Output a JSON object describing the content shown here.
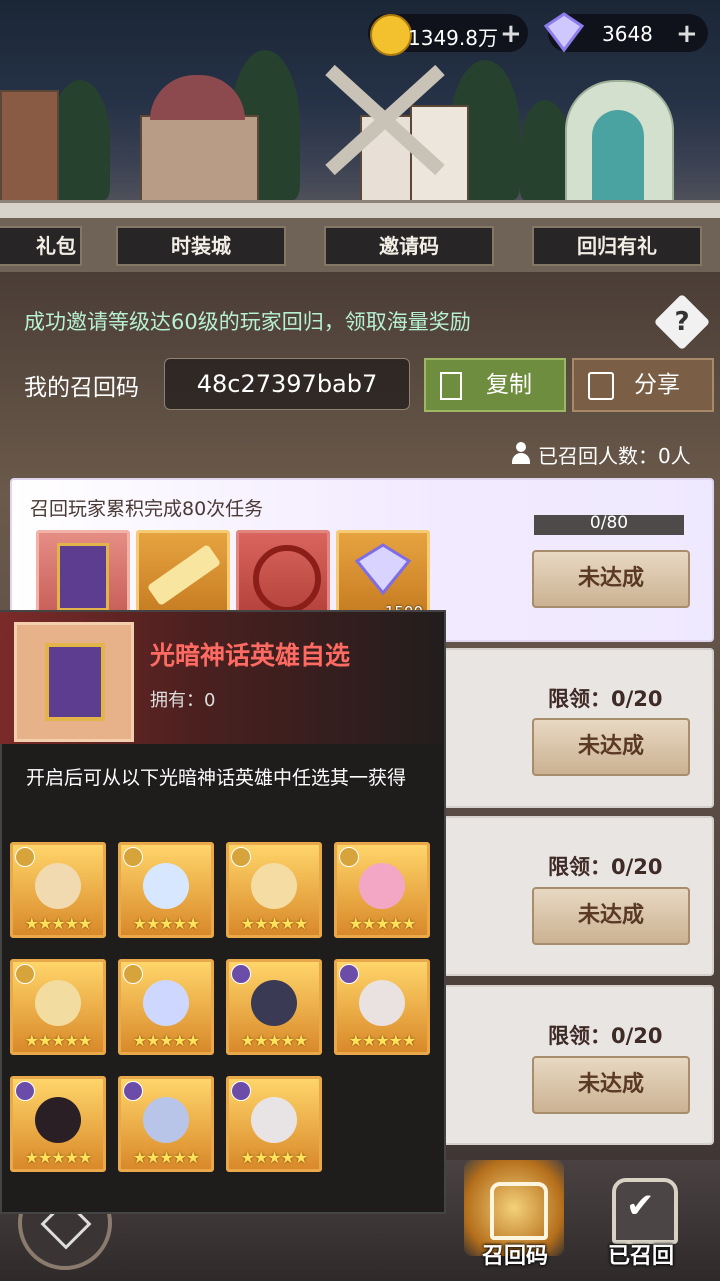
{
  "currency": {
    "gold": "1349.8万",
    "gems": "3648"
  },
  "tabs": [
    "礼包",
    "时装城",
    "邀请码",
    "回归有礼"
  ],
  "invite": {
    "hint": "成功邀请等级达60级的玩家回归，领取海量奖励",
    "code_label": "我的召回码",
    "code": "48c27397bab7",
    "copy_label": "复制",
    "share_label": "分享",
    "recalled": "已召回人数：0人"
  },
  "tasks": [
    {
      "title": "召回玩家累积完成80次任务",
      "progress": "0/80",
      "progress_value": 0,
      "button": "未达成",
      "item_count": "1500"
    },
    {
      "limit": "限领：0/20",
      "button": "未达成"
    },
    {
      "limit": "限领：0/20",
      "button": "未达成"
    },
    {
      "limit": "限领：0/20",
      "button": "未达成"
    }
  ],
  "popup": {
    "title": "光暗神话英雄自选",
    "owned": "拥有：0",
    "description": "开启后可从以下光暗神话英雄中任选其一获得",
    "heroes_count": 11,
    "star_text": "★★★★★"
  },
  "bottom_nav": {
    "recall_code": "召回码",
    "recalled": "已召回"
  },
  "colors": {
    "accent_green": "#6f8d3f",
    "hint_text": "#b8f0d4",
    "popup_title": "#ff6a62"
  }
}
